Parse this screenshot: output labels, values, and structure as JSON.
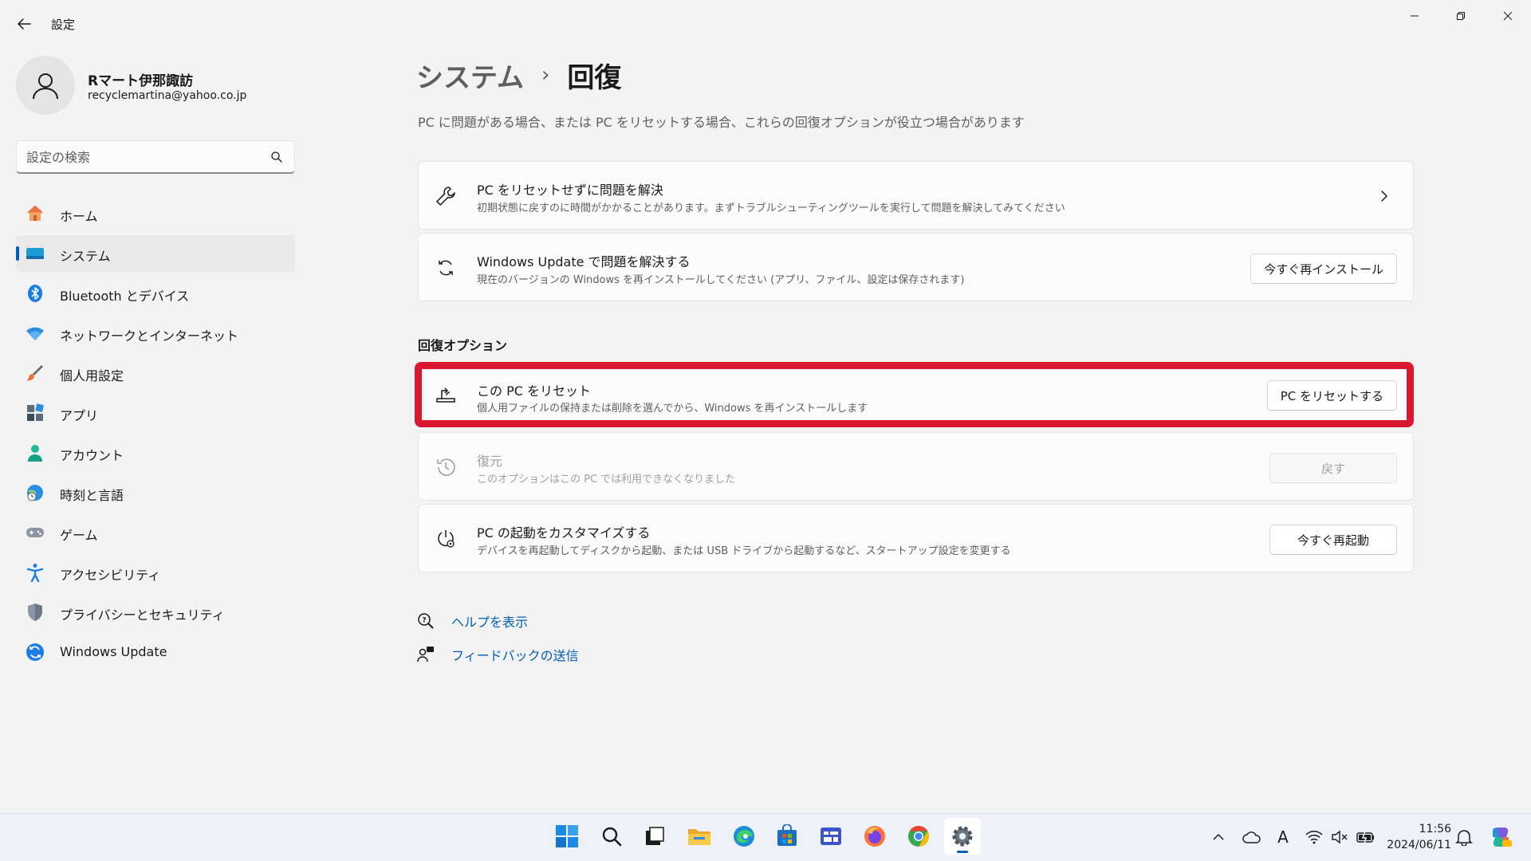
{
  "window": {
    "app_title": "設定"
  },
  "profile": {
    "name": "Rマート伊那諏訪",
    "email": "recyclemartina@yahoo.co.jp"
  },
  "search": {
    "placeholder": "設定の検索"
  },
  "sidebar": {
    "items": [
      {
        "label": "ホーム",
        "icon": "home-icon"
      },
      {
        "label": "システム",
        "icon": "system-icon",
        "active": true
      },
      {
        "label": "Bluetooth とデバイス",
        "icon": "bluetooth-icon"
      },
      {
        "label": "ネットワークとインターネット",
        "icon": "network-icon"
      },
      {
        "label": "個人用設定",
        "icon": "brush-icon"
      },
      {
        "label": "アプリ",
        "icon": "apps-icon"
      },
      {
        "label": "アカウント",
        "icon": "account-icon"
      },
      {
        "label": "時刻と言語",
        "icon": "time-language-icon"
      },
      {
        "label": "ゲーム",
        "icon": "gamepad-icon"
      },
      {
        "label": "アクセシビリティ",
        "icon": "accessibility-icon"
      },
      {
        "label": "プライバシーとセキュリティ",
        "icon": "shield-icon"
      },
      {
        "label": "Windows Update",
        "icon": "windows-update-icon"
      }
    ]
  },
  "main": {
    "breadcrumb_parent": "システム",
    "breadcrumb_separator": "›",
    "breadcrumb_current": "回復",
    "subtitle": "PC に問題がある場合、または PC をリセットする場合、これらの回復オプションが役立つ場合があります",
    "cards_top": [
      {
        "title": "PC をリセットせずに問題を解決",
        "desc": "初期状態に戻すのに時間がかかることがあります。まずトラブルシューティングツールを実行して問題を解決してみてください",
        "icon": "wrench-icon"
      },
      {
        "title": "Windows Update で問題を解決する",
        "desc": "現在のバージョンの Windows を再インストールしてください (アプリ、ファイル、設定は保存されます)",
        "button": "今すぐ再インストール",
        "icon": "refresh-icon"
      }
    ],
    "section_title": "回復オプション",
    "cards_recovery": [
      {
        "title": "この PC をリセット",
        "desc": "個人用ファイルの保持または削除を選んでから、Windows を再インストールします",
        "button": "PC をリセットする",
        "icon": "reset-pc-icon"
      },
      {
        "title": "復元",
        "desc": "このオプションはこの PC では利用できなくなりました",
        "button": "戻す",
        "icon": "history-icon",
        "disabled": true
      },
      {
        "title": "PC の起動をカスタマイズする",
        "desc": "デバイスを再起動してディスクから起動、または USB ドライブから起動するなど、スタートアップ設定を変更する",
        "button": "今すぐ再起動",
        "icon": "startup-icon"
      }
    ],
    "links": [
      {
        "label": "ヘルプを表示",
        "icon": "help-icon"
      },
      {
        "label": "フィードバックの送信",
        "icon": "feedback-icon"
      }
    ]
  },
  "accent_color": "#005fb8",
  "highlight_color": "#d9172e",
  "taskbar": {
    "clock_time": "11:56",
    "clock_date": "2024/06/11",
    "tray_ime": "A"
  }
}
